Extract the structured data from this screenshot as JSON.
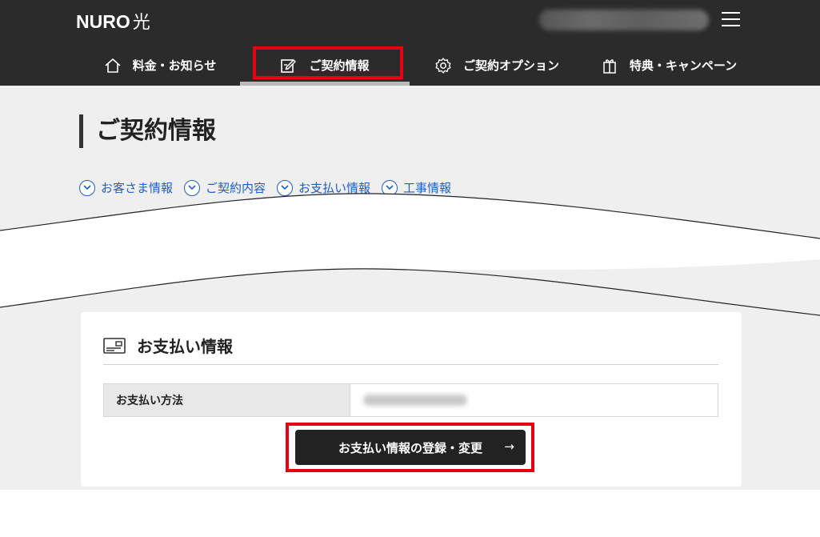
{
  "header": {
    "logo": "NURO",
    "logo_kanji": "光"
  },
  "nav": {
    "items": [
      {
        "label": "料金・お知らせ",
        "icon": "house-icon"
      },
      {
        "label": "ご契約情報",
        "icon": "edit-document-icon",
        "active": true
      },
      {
        "label": "ご契約オプション",
        "icon": "gear-icon"
      },
      {
        "label": "特典・キャンペーン",
        "icon": "gift-icon"
      }
    ]
  },
  "page": {
    "title": "ご契約情報",
    "anchors": [
      "お客さま情報",
      "ご契約内容",
      "お支払い情報",
      "工事情報"
    ]
  },
  "payment": {
    "title": "お支払い情報",
    "icon": "card-icon",
    "method_label": "お支払い方法",
    "button_label": "お支払い情報の登録・変更",
    "button_arrow": "→"
  },
  "colors": {
    "header_bg": "#2b2b2b",
    "highlight": "#e60012",
    "link": "#1f5fbf",
    "content_bg": "#efefef"
  }
}
